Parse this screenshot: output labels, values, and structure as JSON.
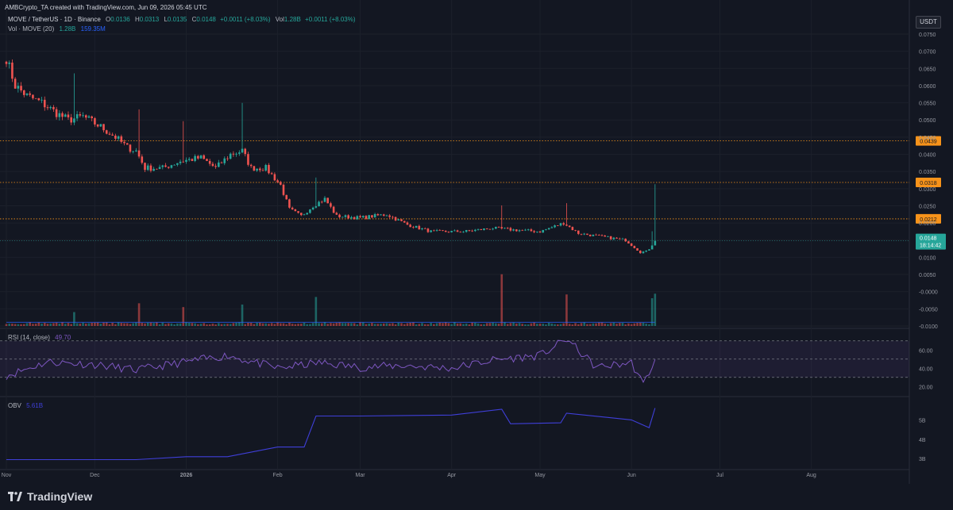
{
  "attribution": "AMBCrypto_TA created with TradingView.com, Jun 09, 2026 05:45 UTC",
  "legend": {
    "symbol": "MOVE / TetherUS · 1D · Binance",
    "o_label": "O",
    "o": "0.0136",
    "h_label": "H",
    "h": "0.0313",
    "l_label": "L",
    "l": "0.0135",
    "c_label": "C",
    "c": "0.0148",
    "change": "+0.0011 (+8.03%)",
    "vol_label": "Vol",
    "vol": "1.28B",
    "vol_change": "+0.0011 (+8.03%)",
    "vol_study": "Vol · MOVE (20)",
    "vol_study_v1": "1.28B",
    "vol_study_v2": "159.35M"
  },
  "currency_badge": "USDT",
  "rsi_legend": {
    "label": "RSI (14, close)",
    "value": "49.70"
  },
  "obv_legend": {
    "label": "OBV",
    "value": "5.61B"
  },
  "brand": "TradingView",
  "colors": {
    "up": "#26a69a",
    "down": "#ef5350",
    "rsi": "#7e57c2",
    "obv": "#3f3fd9",
    "level": "#f7931a",
    "bg": "#131722"
  },
  "chart_data": [
    {
      "type": "candlestick",
      "y_ticks": [
        "0.0750",
        "0.0700",
        "0.0650",
        "0.0600",
        "0.0550",
        "0.0500",
        "0.0450",
        "0.0400",
        "0.0350",
        "0.0300",
        "0.0250",
        "0.0200",
        "0.0150",
        "0.0100",
        "0.0050",
        "-0.0000",
        "-0.0050",
        "-0.0100"
      ],
      "ylim": [
        -0.01,
        0.075
      ],
      "x_ticks": [
        "Nov",
        "Dec",
        "2026",
        "Feb",
        "Mar",
        "Apr",
        "May",
        "Jun",
        "Jul",
        "Aug"
      ],
      "horizontal_levels": [
        {
          "label": "0.0439",
          "value": 0.0439
        },
        {
          "label": "0.0318",
          "value": 0.0318
        },
        {
          "label": "0.0212",
          "value": 0.0212
        }
      ],
      "last_price": {
        "label": "0.0148",
        "countdown": "18:14:42",
        "value": 0.0148
      },
      "close_path": [
        {
          "date": "2025-11-01",
          "close": 0.068
        },
        {
          "date": "2025-11-04",
          "close": 0.06
        },
        {
          "date": "2025-11-08",
          "close": 0.057
        },
        {
          "date": "2025-11-13",
          "close": 0.055
        },
        {
          "date": "2025-11-18",
          "close": 0.052
        },
        {
          "date": "2025-11-22",
          "close": 0.05
        },
        {
          "date": "2025-11-27",
          "close": 0.051
        },
        {
          "date": "2025-12-03",
          "close": 0.048
        },
        {
          "date": "2025-12-08",
          "close": 0.045
        },
        {
          "date": "2025-12-12",
          "close": 0.042
        },
        {
          "date": "2025-12-15",
          "close": 0.041
        },
        {
          "date": "2025-12-18",
          "close": 0.036
        },
        {
          "date": "2025-12-24",
          "close": 0.036
        },
        {
          "date": "2025-12-30",
          "close": 0.038
        },
        {
          "date": "2026-01-06",
          "close": 0.039
        },
        {
          "date": "2026-01-11",
          "close": 0.036
        },
        {
          "date": "2026-01-16",
          "close": 0.04
        },
        {
          "date": "2026-01-20",
          "close": 0.041
        },
        {
          "date": "2026-01-23",
          "close": 0.036
        },
        {
          "date": "2026-01-28",
          "close": 0.036
        },
        {
          "date": "2026-02-02",
          "close": 0.031
        },
        {
          "date": "2026-02-05",
          "close": 0.024
        },
        {
          "date": "2026-02-09",
          "close": 0.022
        },
        {
          "date": "2026-02-13",
          "close": 0.025
        },
        {
          "date": "2026-02-17",
          "close": 0.027
        },
        {
          "date": "2026-02-21",
          "close": 0.022
        },
        {
          "date": "2026-03-01",
          "close": 0.0215
        },
        {
          "date": "2026-03-10",
          "close": 0.0225
        },
        {
          "date": "2026-03-17",
          "close": 0.0195
        },
        {
          "date": "2026-03-25",
          "close": 0.0175
        },
        {
          "date": "2026-04-05",
          "close": 0.0175
        },
        {
          "date": "2026-04-15",
          "close": 0.0185
        },
        {
          "date": "2026-04-22",
          "close": 0.018
        },
        {
          "date": "2026-05-01",
          "close": 0.0175
        },
        {
          "date": "2026-05-09",
          "close": 0.02
        },
        {
          "date": "2026-05-14",
          "close": 0.017
        },
        {
          "date": "2026-05-22",
          "close": 0.016
        },
        {
          "date": "2026-05-30",
          "close": 0.015
        },
        {
          "date": "2026-06-04",
          "close": 0.0115
        },
        {
          "date": "2026-06-06",
          "close": 0.0117
        },
        {
          "date": "2026-06-07",
          "close": 0.0125
        },
        {
          "date": "2026-06-08",
          "close": 0.0137
        },
        {
          "date": "2026-06-09",
          "close": 0.0148
        }
      ],
      "volume_spikes": [
        {
          "date": "2025-11-24",
          "volume": 0.55
        },
        {
          "date": "2025-12-16",
          "volume": 0.9
        },
        {
          "date": "2025-12-31",
          "volume": 0.75
        },
        {
          "date": "2026-01-20",
          "volume": 0.85
        },
        {
          "date": "2026-02-14",
          "volume": 1.15
        },
        {
          "date": "2026-04-18",
          "volume": 2.05
        },
        {
          "date": "2026-05-10",
          "volume": 1.25
        },
        {
          "date": "2026-06-08",
          "volume": 1.1
        },
        {
          "date": "2026-06-09",
          "volume": 1.28
        }
      ],
      "volume_ma_level": 0.15
    },
    {
      "type": "line",
      "name": "RSI (14, close)",
      "y_ticks": [
        "60.00",
        "40.00",
        "20.00"
      ],
      "ylim": [
        15,
        75
      ],
      "bands": [
        30,
        50,
        70
      ],
      "x": [
        "2025-11-01",
        "2025-11-15",
        "2025-12-01",
        "2025-12-15",
        "2026-01-01",
        "2026-01-15",
        "2026-02-01",
        "2026-02-15",
        "2026-03-01",
        "2026-03-15",
        "2026-04-01",
        "2026-04-15",
        "2026-05-01",
        "2026-05-10",
        "2026-05-20",
        "2026-06-01",
        "2026-06-05",
        "2026-06-09"
      ],
      "values": [
        32,
        47,
        44,
        38,
        47,
        54,
        40,
        46,
        41,
        43,
        40,
        49,
        54,
        72,
        41,
        46,
        22,
        49.7
      ]
    },
    {
      "type": "line",
      "name": "OBV",
      "y_ticks": [
        "5B",
        "4B",
        "3B"
      ],
      "ylim": [
        2.6,
        6.0
      ],
      "x": [
        "2025-11-01",
        "2025-12-01",
        "2025-12-15",
        "2026-01-01",
        "2026-01-15",
        "2026-02-01",
        "2026-02-10",
        "2026-02-14",
        "2026-03-01",
        "2026-04-01",
        "2026-04-18",
        "2026-04-21",
        "2026-05-08",
        "2026-05-10",
        "2026-06-01",
        "2026-06-07",
        "2026-06-09"
      ],
      "values": [
        2.95,
        2.95,
        2.95,
        3.1,
        3.1,
        3.6,
        3.6,
        5.2,
        5.2,
        5.25,
        5.55,
        4.8,
        4.85,
        5.35,
        5.0,
        4.6,
        5.61
      ]
    }
  ]
}
